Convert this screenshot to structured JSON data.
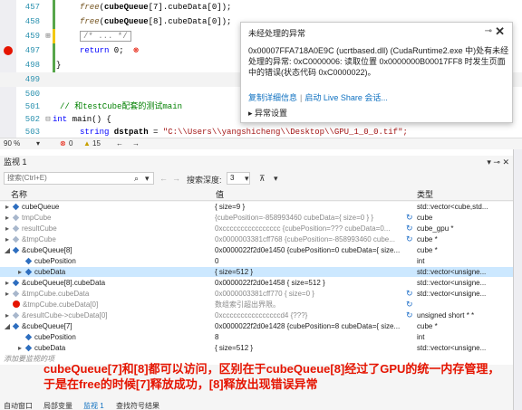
{
  "editor": {
    "lines": [
      {
        "num": "457",
        "parts": [
          {
            "t": "free",
            "c": "fn"
          },
          {
            "t": "(",
            "c": ""
          },
          {
            "t": "cubeQueue",
            "c": "bold"
          },
          {
            "t": "[7].cubeData[0]);",
            "c": ""
          }
        ]
      },
      {
        "num": "458",
        "parts": [
          {
            "t": "free",
            "c": "fn"
          },
          {
            "t": "(",
            "c": ""
          },
          {
            "t": "cubeQueue",
            "c": "bold"
          },
          {
            "t": "[8].cubeData[0]);",
            "c": ""
          }
        ]
      },
      {
        "num": "459",
        "parts": [
          {
            "t": "/* ... */",
            "c": "collapsed"
          }
        ]
      },
      {
        "num": "497",
        "parts": [
          {
            "t": "return",
            "c": "kw"
          },
          {
            "t": " 0;",
            "c": ""
          }
        ]
      },
      {
        "num": "498",
        "parts": [
          {
            "t": "}",
            "c": ""
          }
        ]
      },
      {
        "num": "499",
        "parts": []
      },
      {
        "num": "500",
        "parts": []
      },
      {
        "num": "501",
        "parts": [
          {
            "t": "// 和testCube配套的测试main",
            "c": "cm"
          }
        ]
      },
      {
        "num": "502",
        "parts": [
          {
            "t": "int",
            "c": "kw"
          },
          {
            "t": " main() {",
            "c": ""
          }
        ]
      },
      {
        "num": "503",
        "parts": [
          {
            "t": "string",
            "c": "kw"
          },
          {
            "t": " dstpath",
            "c": "bold"
          },
          {
            "t": " = ",
            "c": ""
          },
          {
            "t": "\"C:\\\\Users\\\\yangshicheng\\\\Desktop\\\\GPU_1_0_0.tif\";",
            "c": "str"
          }
        ]
      }
    ]
  },
  "exception": {
    "title": "未经处理的异常",
    "pin": "⊸",
    "close": "✕",
    "message": "0x00007FFA718A0E9C (ucrtbased.dll) (CudaRuntime2.exe 中)处有未经处理的异常: 0xC0000006: 读取位置 0x0000000B00017FF8 时发生页面中的错误(状态代码 0xC0000022)。",
    "link_copy": "复制详细信息",
    "link_share": "启动 Live Share 会话...",
    "settings": "异常设置"
  },
  "editor_status": {
    "zoom": "90 %",
    "errors": "0",
    "warnings": "15"
  },
  "watch": {
    "title": "监视 1",
    "search_placeholder": "搜索(Ctrl+E)",
    "depth_label": "搜索深度:",
    "depth_value": "3",
    "col_name": "名称",
    "col_value": "值",
    "col_type": "类型",
    "rows": [
      {
        "indent": 0,
        "arrow": "▸",
        "icon": "var",
        "name": "cubeQueue",
        "value": "{ size=9 }",
        "type": "std::vector<cube,std...",
        "dim": false,
        "refresh": false
      },
      {
        "indent": 0,
        "arrow": "▸",
        "icon": "var-dim",
        "name": "tmpCube",
        "value": "{cubePosition=-858993460 cubeData={ size=0 } }",
        "type": "cube",
        "dim": true,
        "refresh": true
      },
      {
        "indent": 0,
        "arrow": "▸",
        "icon": "var-dim",
        "name": "resultCube",
        "value": "0xcccccccccccccccc {cubePosition=??? cubeData=0...",
        "type": "cube_gpu *",
        "dim": true,
        "refresh": true
      },
      {
        "indent": 0,
        "arrow": "▸",
        "icon": "var-dim",
        "name": "&tmpCube",
        "value": "0x0000003381cff768 {cubePosition=-858993460 cube...",
        "type": "cube *",
        "dim": true,
        "refresh": true
      },
      {
        "indent": 0,
        "arrow": "◢",
        "icon": "var",
        "name": "&cubeQueue[8]",
        "value": "0x0000022f2d0e1450 {cubePosition=0 cubeData={ size...",
        "type": "cube *",
        "dim": false,
        "refresh": false
      },
      {
        "indent": 1,
        "arrow": "",
        "icon": "var",
        "name": "cubePosition",
        "value": "0",
        "type": "int",
        "dim": false,
        "refresh": false
      },
      {
        "indent": 1,
        "arrow": "▸",
        "icon": "var",
        "name": "cubeData",
        "value": "{ size=512 }",
        "type": "std::vector<unsigne...",
        "dim": false,
        "refresh": false,
        "sel": true
      },
      {
        "indent": 0,
        "arrow": "▸",
        "icon": "var",
        "name": "&cubeQueue[8].cubeData",
        "value": "0x0000022f2d0e1458 { size=512 }",
        "type": "std::vector<unsigne...",
        "dim": false,
        "refresh": false
      },
      {
        "indent": 0,
        "arrow": "▸",
        "icon": "var-dim",
        "name": "&tmpCube.cubeData",
        "value": "0x0000003381cff770 { size=0 }",
        "type": "std::vector<unsigne...",
        "dim": true,
        "refresh": true
      },
      {
        "indent": 0,
        "arrow": "",
        "icon": "error",
        "name": "&tmpCube.cubeData[0]",
        "value": "数组索引超出界限。",
        "type": "",
        "dim": true,
        "refresh": true
      },
      {
        "indent": 0,
        "arrow": "▸",
        "icon": "var-dim",
        "name": "&resultCube->cubeData[0]",
        "value": "0xccccccccccccccccd4 {???}",
        "type": "unsigned short * *",
        "dim": true,
        "refresh": true
      },
      {
        "indent": 0,
        "arrow": "◢",
        "icon": "var",
        "name": "&cubeQueue[7]",
        "value": "0x0000022f2d0e1428 {cubePosition=8 cubeData={ size...",
        "type": "cube *",
        "dim": false,
        "refresh": false
      },
      {
        "indent": 1,
        "arrow": "",
        "icon": "var",
        "name": "cubePosition",
        "value": "8",
        "type": "int",
        "dim": false,
        "refresh": false
      },
      {
        "indent": 1,
        "arrow": "▸",
        "icon": "var",
        "name": "cubeData",
        "value": "{ size=512 }",
        "type": "std::vector<unsigne...",
        "dim": false,
        "refresh": false
      }
    ],
    "add_hint": "添加要监视的项"
  },
  "annotation": {
    "line1": "cubeQueue[7]和[8]都可以访问，区别在于cubeQueue[8]经过了GPU的统一内存管理，",
    "line2": "于是在free的时候[7]释放成功，[8]释放出现错误异常"
  },
  "bottom_tabs": [
    "自动窗口",
    "局部变量",
    "监视 1",
    "查找符号结果"
  ]
}
